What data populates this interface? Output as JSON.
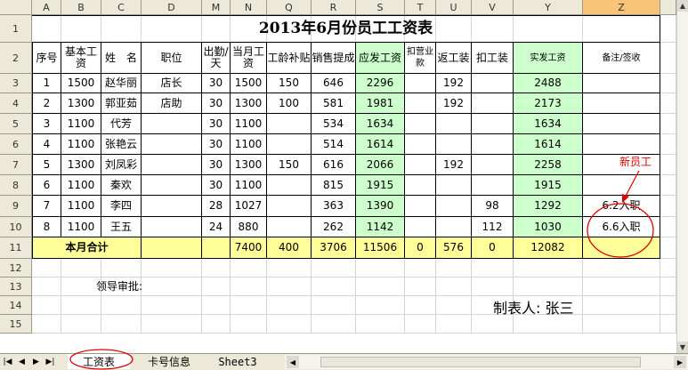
{
  "columns": [
    "A",
    "B",
    "C",
    "D",
    "M",
    "N",
    "Q",
    "R",
    "S",
    "T",
    "U",
    "V",
    "Y",
    "Z"
  ],
  "rows": [
    "1",
    "2",
    "3",
    "4",
    "5",
    "6",
    "7",
    "8",
    "9",
    "10",
    "11",
    "12",
    "13",
    "14",
    "15"
  ],
  "title": "2013年6月份员工工资表",
  "headers": [
    "序号",
    "基本工资",
    "姓　名",
    "职位",
    "出勤/天",
    "当月工资",
    "工龄补贴",
    "销售提成",
    "应发工资",
    "扣营业款",
    "返工装",
    "扣工装",
    "实发工资",
    "备注/签收"
  ],
  "data_rows": [
    [
      "1",
      "1500",
      "赵华丽",
      "店长",
      "30",
      "1500",
      "150",
      "646",
      "2296",
      "",
      "192",
      "",
      "2488",
      ""
    ],
    [
      "2",
      "1300",
      "郭亚茹",
      "店助",
      "30",
      "1300",
      "100",
      "581",
      "1981",
      "",
      "192",
      "",
      "2173",
      ""
    ],
    [
      "3",
      "1100",
      "代芳",
      "",
      "30",
      "1100",
      "",
      "534",
      "1634",
      "",
      "",
      "",
      "1634",
      ""
    ],
    [
      "4",
      "1100",
      "张艳云",
      "",
      "30",
      "1100",
      "",
      "514",
      "1614",
      "",
      "",
      "",
      "1614",
      ""
    ],
    [
      "5",
      "1300",
      "刘凤彩",
      "",
      "30",
      "1300",
      "150",
      "616",
      "2066",
      "",
      "192",
      "",
      "2258",
      ""
    ],
    [
      "6",
      "1100",
      "秦欢",
      "",
      "30",
      "1100",
      "",
      "815",
      "1915",
      "",
      "",
      "",
      "1915",
      ""
    ],
    [
      "7",
      "1100",
      "李四",
      "",
      "28",
      "1027",
      "",
      "363",
      "1390",
      "",
      "",
      "98",
      "1292",
      "6.2入职"
    ],
    [
      "8",
      "1100",
      "王五",
      "",
      "24",
      "880",
      "",
      "262",
      "1142",
      "",
      "",
      "112",
      "1030",
      "6.6入职"
    ]
  ],
  "total": {
    "label": "本月合计",
    "values": [
      "",
      "",
      "7400",
      "400",
      "3706",
      "11506",
      "0",
      "576",
      "0",
      "12082",
      ""
    ]
  },
  "approval_label": "领导审批:",
  "preparer_label": "制表人: 张三",
  "annotation": "新员工",
  "tabs": [
    "工资表",
    "卡号信息",
    "Sheet3"
  ],
  "selected_column": "Z",
  "colors": {
    "green": "#ccffcc",
    "yellow": "#ffff99",
    "annotation_red": "#e00000",
    "header_selected": "#f8c47a"
  }
}
